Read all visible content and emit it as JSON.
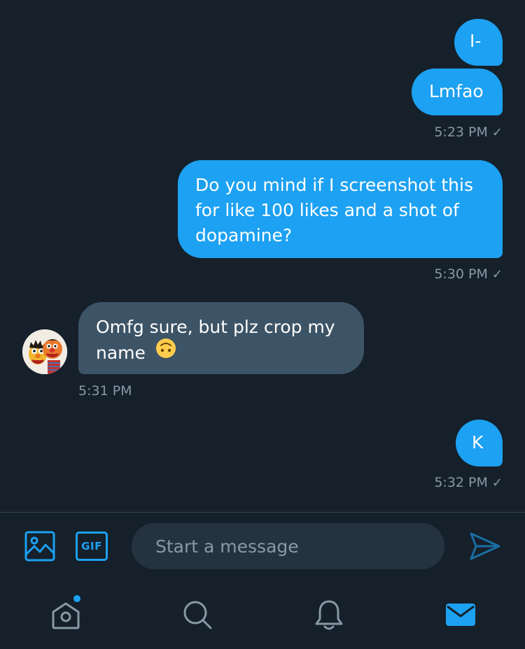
{
  "messages": [
    {
      "direction": "out",
      "text": "I-"
    },
    {
      "direction": "out",
      "text": "Lmfao"
    },
    {
      "direction": "out",
      "text": "Do you mind if I screenshot this for like 100 likes and a shot of dopamine?"
    },
    {
      "direction": "in",
      "text": "Omfg sure, but plz crop my name",
      "emoji": "upside-down-face"
    },
    {
      "direction": "out",
      "text": "K"
    }
  ],
  "timestamps": [
    "5:23 PM",
    "5:30 PM",
    "5:31 PM",
    "5:32 PM"
  ],
  "read_mark": "✓",
  "composer": {
    "placeholder": "Start a message",
    "gif_label": "GIF"
  },
  "tabs": [
    {
      "name": "home",
      "icon": "home-icon",
      "has_notification_dot": true
    },
    {
      "name": "search",
      "icon": "search-icon"
    },
    {
      "name": "notifications",
      "icon": "bell-icon"
    },
    {
      "name": "messages",
      "icon": "mail-icon",
      "active": true
    }
  ],
  "colors": {
    "background": "#15202b",
    "outgoing_bubble": "#1da1f2",
    "incoming_bubble": "#3d5466",
    "muted_text": "#8899a6",
    "accent": "#1da1f2",
    "divider": "#38444d"
  }
}
